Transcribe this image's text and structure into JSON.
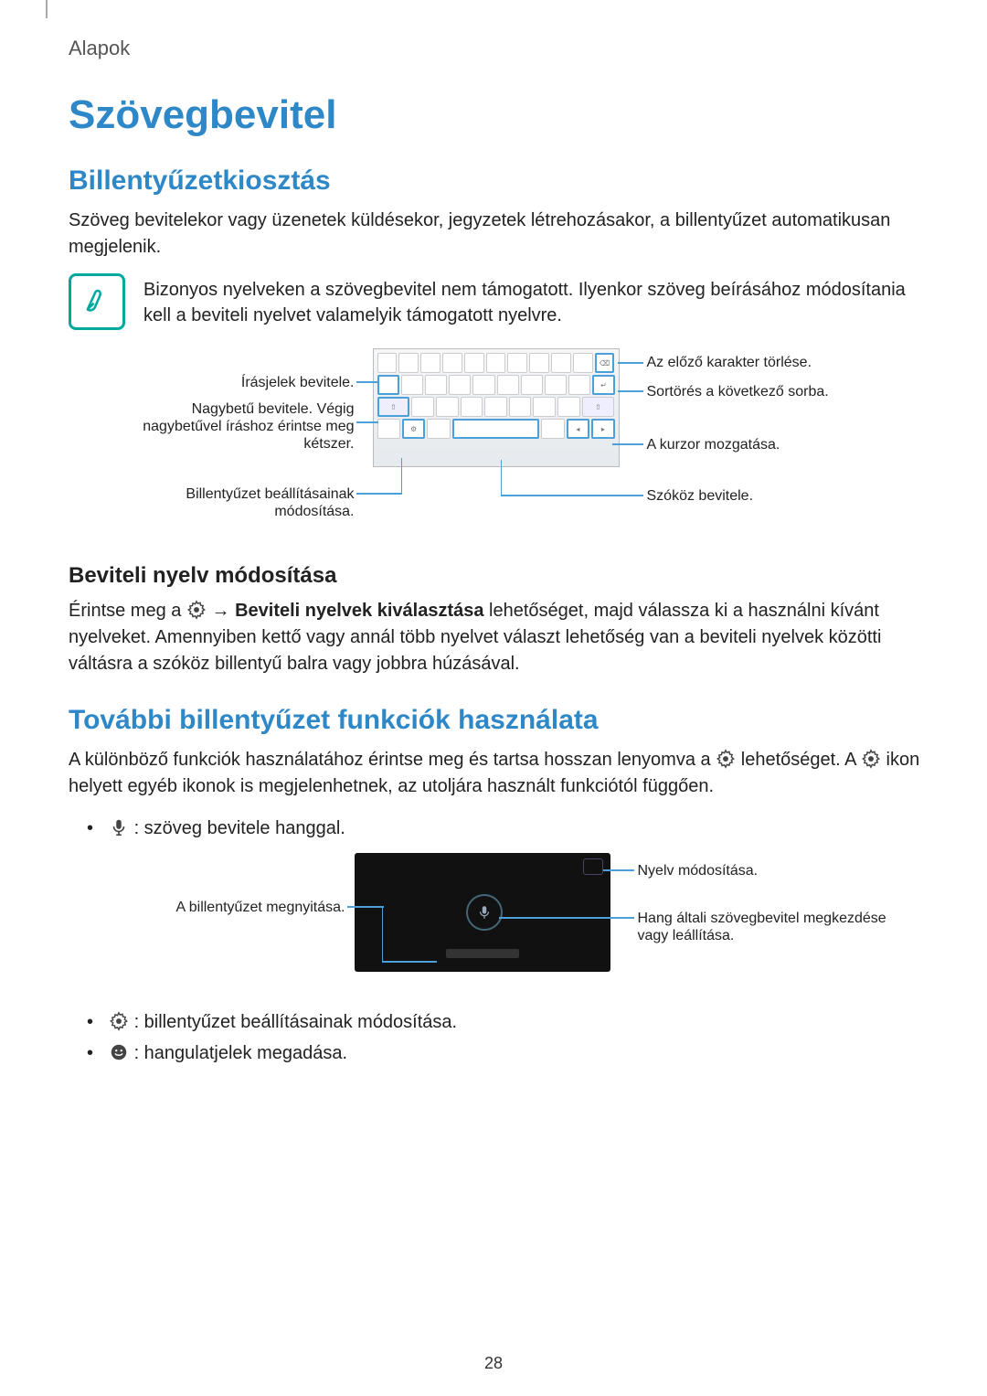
{
  "header": {
    "chapter": "Alapok"
  },
  "title": "Szövegbevitel",
  "section1": {
    "heading": "Billentyűzetkiosztás",
    "para1": "Szöveg bevitelekor vagy üzenetek küldésekor, jegyzetek létrehozásakor, a billentyűzet automatikusan megjelenik.",
    "note": "Bizonyos nyelveken a szövegbevitel nem támogatott. Ilyenkor szöveg beírásához módosítania kell a beviteli nyelvet valamelyik támogatott nyelvre."
  },
  "kbd_callouts": {
    "left1": "Írásjelek bevitele.",
    "left2": "Nagybetű bevitele. Végig nagybetűvel íráshoz érintse meg kétszer.",
    "left3": "Billentyűzet beállításainak módosítása.",
    "right1": "Az előző karakter törlése.",
    "right2": "Sortörés a következő sorba.",
    "right3": "A kurzor mozgatása.",
    "right4": "Szóköz bevitele."
  },
  "subsection1": {
    "heading": "Beviteli nyelv módosítása",
    "text_before_arrow": "Érintse meg a ",
    "arrow": " → ",
    "bold_text": "Beviteli nyelvek kiválasztása",
    "text_after_bold": " lehetőséget, majd válassza ki a használni kívánt nyelveket. Amennyiben kettő vagy annál több nyelvet választ lehetőség van a beviteli nyelvek közötti váltásra a szóköz billentyű balra vagy jobbra húzásával."
  },
  "section2": {
    "heading": "További billentyűzet funkciók használata",
    "para_before_icon1": "A különböző funkciók használatához érintse meg és tartsa hosszan lenyomva a ",
    "para_mid": " lehetőséget. A ",
    "para_after_icon2": " ikon helyett egyéb ikonok is megjelenhetnek, az utoljára használt funkciótól függően.",
    "bullet_voice": " : szöveg bevitele hanggal.",
    "bullet_settings": " : billentyűzet beállításainak módosítása.",
    "bullet_emoji": " : hangulatjelek megadása."
  },
  "voice_callouts": {
    "left": "A billentyűzet megnyitása.",
    "right1": "Nyelv módosítása.",
    "right2": "Hang általi szövegbevitel megkezdése vagy leállítása."
  },
  "page_number": "28"
}
